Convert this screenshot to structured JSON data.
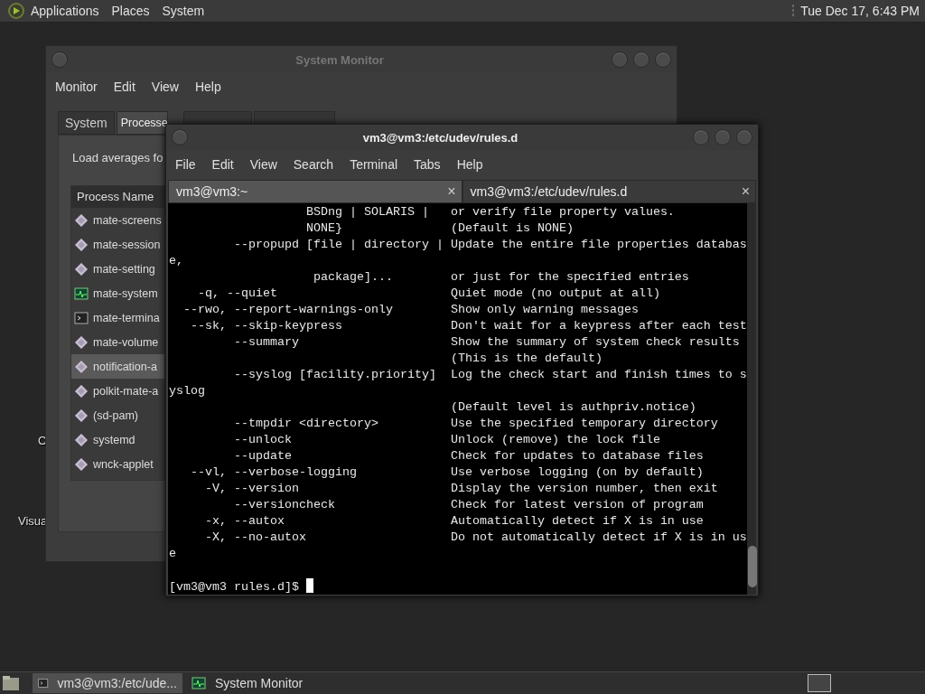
{
  "top_panel": {
    "menus": [
      "Applications",
      "Places",
      "System"
    ],
    "clock": "Tue Dec 17,  6:43 PM"
  },
  "desktop_icons": [
    {
      "label": "C"
    },
    {
      "label": "Visua"
    }
  ],
  "system_monitor": {
    "title": "System Monitor",
    "menus": [
      "Monitor",
      "Edit",
      "View",
      "Help"
    ],
    "tabs": [
      {
        "label": "System",
        "selected": false
      },
      {
        "label": "Processe",
        "selected": true
      }
    ],
    "load_averages": "Load averages fo",
    "column": "Process Name",
    "processes": [
      {
        "name": "mate-screens",
        "kind": "generic",
        "selected": false
      },
      {
        "name": "mate-session",
        "kind": "generic",
        "selected": false
      },
      {
        "name": "mate-setting",
        "kind": "generic",
        "selected": false
      },
      {
        "name": "mate-system",
        "kind": "monitor",
        "selected": false
      },
      {
        "name": "mate-termina",
        "kind": "terminal",
        "selected": false
      },
      {
        "name": "mate-volume",
        "kind": "generic",
        "selected": false
      },
      {
        "name": "notification-a",
        "kind": "generic",
        "selected": true
      },
      {
        "name": "polkit-mate-a",
        "kind": "generic",
        "selected": false
      },
      {
        "name": "(sd-pam)",
        "kind": "generic",
        "selected": false
      },
      {
        "name": "systemd",
        "kind": "generic",
        "selected": false
      },
      {
        "name": "wnck-applet",
        "kind": "generic",
        "selected": false
      }
    ]
  },
  "terminal": {
    "title": "vm3@vm3:/etc/udev/rules.d",
    "menus": [
      "File",
      "Edit",
      "View",
      "Search",
      "Terminal",
      "Tabs",
      "Help"
    ],
    "tabs": [
      {
        "label": "vm3@vm3:~",
        "close": "×",
        "selected": false
      },
      {
        "label": "vm3@vm3:/etc/udev/rules.d",
        "close": "×",
        "selected": true
      }
    ],
    "lines": [
      "                   BSDng | SOLARIS |   or verify file property values.",
      "                   NONE}               (Default is NONE)",
      "         --propupd [file | directory | Update the entire file properties databas",
      "e,",
      "                    package]...        or just for the specified entries",
      "    -q, --quiet                        Quiet mode (no output at all)",
      "  --rwo, --report-warnings-only        Show only warning messages",
      "   --sk, --skip-keypress               Don't wait for a keypress after each test",
      "         --summary                     Show the summary of system check results",
      "                                       (This is the default)",
      "         --syslog [facility.priority]  Log the check start and finish times to s",
      "yslog",
      "                                       (Default level is authpriv.notice)",
      "         --tmpdir <directory>          Use the specified temporary directory",
      "         --unlock                      Unlock (remove) the lock file",
      "         --update                      Check for updates to database files",
      "   --vl, --verbose-logging             Use verbose logging (on by default)",
      "     -V, --version                     Display the version number, then exit",
      "         --versioncheck                Check for latest version of program",
      "     -x, --autox                       Automatically detect if X is in use",
      "     -X, --no-autox                    Do not automatically detect if X is in us",
      "e"
    ],
    "prompt": "[vm3@vm3 rules.d]$ "
  },
  "taskbar": {
    "tasks": [
      {
        "label": "vm3@vm3:/etc/ude...",
        "kind": "terminal",
        "selected": true
      },
      {
        "label": "System Monitor",
        "kind": "monitor",
        "selected": false
      }
    ]
  }
}
